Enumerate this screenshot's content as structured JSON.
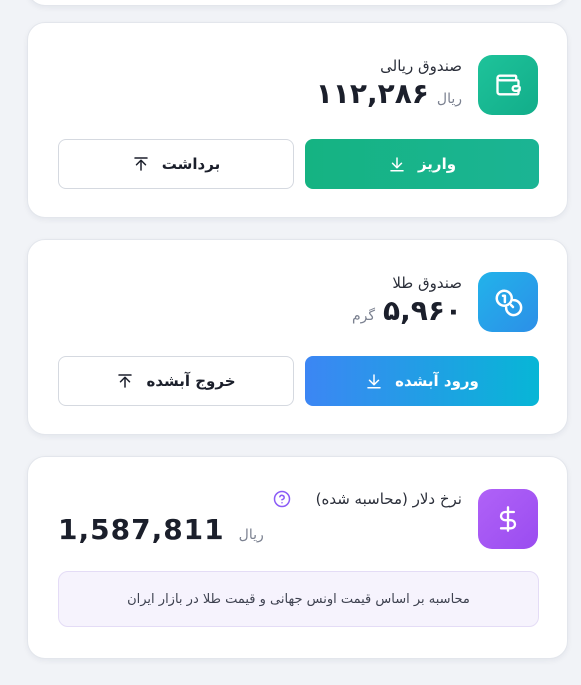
{
  "rial_fund": {
    "title": "صندوق ریالی",
    "amount": "۱۱۲,۲۸۶",
    "unit": "ریال",
    "deposit_label": "واریز",
    "withdraw_label": "برداشت",
    "icon": "wallet-icon",
    "accent": "#17b58a"
  },
  "gold_fund": {
    "title": "صندوق طلا",
    "amount": "۵,۹۶۰",
    "unit": "گرم",
    "enter_label": "ورود آبشده",
    "exit_label": "خروج آبشده",
    "icon": "coins-icon",
    "accent": "#1e9be6"
  },
  "dollar_rate": {
    "title": "نرخ دلار (محاسبه شده)",
    "amount": "1,587,811",
    "unit": "ریال",
    "note": "محاسبه بر اساس قیمت اونس جهانی و قیمت طلا در بازار ایران",
    "icon": "dollar-icon",
    "accent": "#a057f5"
  }
}
